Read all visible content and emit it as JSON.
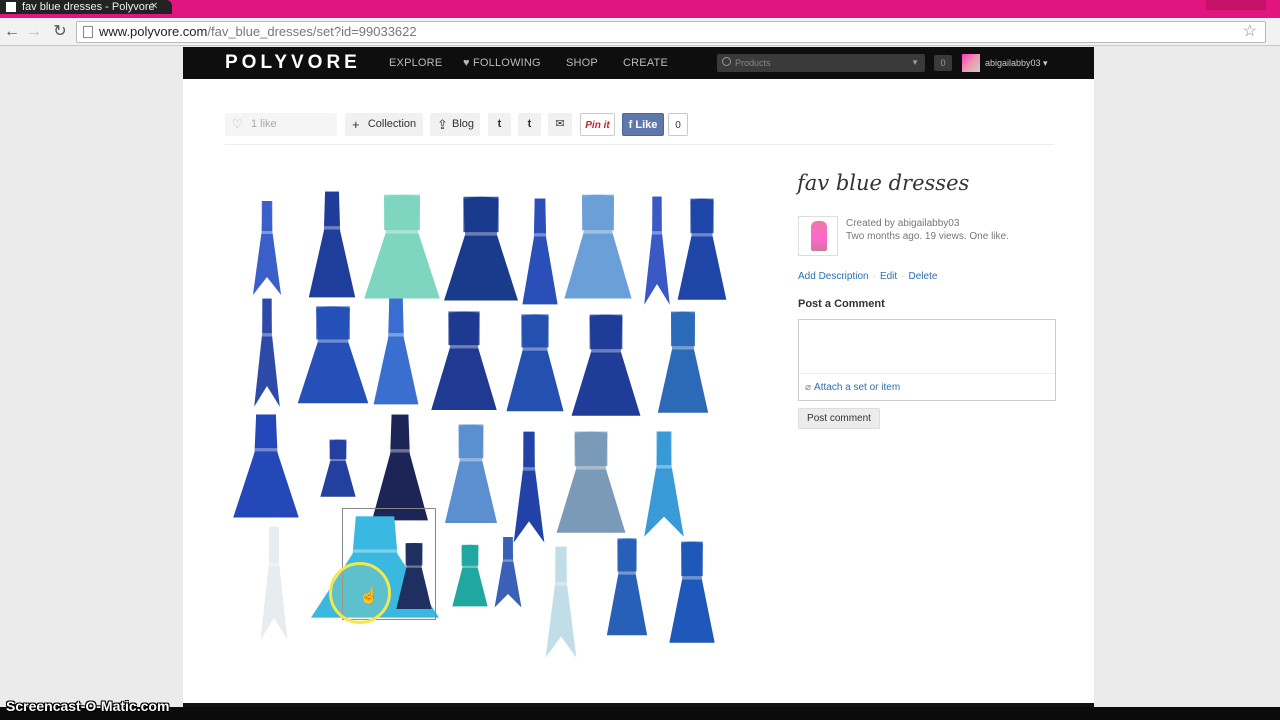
{
  "browser": {
    "tab_title": "fav blue dresses - Polyvore",
    "url_host": "www.polyvore.com",
    "url_path": "/fav_blue_dresses/set?id=99033622",
    "colors": {
      "tabstrip": "#e0157f"
    }
  },
  "site": {
    "logo": "POLYVORE",
    "nav": [
      "EXPLORE",
      "FOLLOWING",
      "SHOP",
      "CREATE"
    ],
    "search_placeholder": "Products",
    "notification_count": "0",
    "username": "abigailabby03"
  },
  "actions": {
    "like_label": "1 like",
    "collection_label": "Collection",
    "blog_label": "Blog",
    "pinit_label": "Pin it",
    "fb_like_label": "Like",
    "fb_like_count": "0"
  },
  "set": {
    "title": "fav blue dresses",
    "created_by": "Created by abigailabby03",
    "stats": "Two months ago. 19 views. One like.",
    "links": [
      "Add Description",
      "Edit",
      "Delete"
    ],
    "comment_heading": "Post a Comment",
    "attach_label": "Attach a set or item",
    "post_button": "Post comment"
  },
  "overlay": {
    "watermark": "Screencast-O-Matic.com"
  }
}
